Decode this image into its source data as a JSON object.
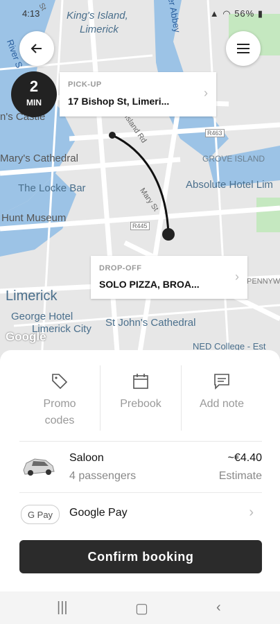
{
  "status_bar": {
    "time": "4:13",
    "battery": "56%"
  },
  "map": {
    "labels": [
      {
        "id": "kings-island",
        "text": "King's Island,"
      },
      {
        "id": "limerick-sub",
        "text": "Limerick"
      },
      {
        "id": "castle",
        "text": "n's Castle"
      },
      {
        "id": "marys",
        "text": "Mary's Cathedral"
      },
      {
        "id": "locke",
        "text": "The Locke Bar"
      },
      {
        "id": "hunt",
        "text": "Hunt Museum"
      },
      {
        "id": "limerick",
        "text": "Limerick"
      },
      {
        "id": "george",
        "text": "George Hotel"
      },
      {
        "id": "george2",
        "text": "Limerick City"
      },
      {
        "id": "johns",
        "text": "St John's Cathedral"
      },
      {
        "id": "absolute",
        "text": "Absolute Hotel Lim"
      },
      {
        "id": "grove",
        "text": "GROVE ISLAND"
      },
      {
        "id": "ned",
        "text": "NED College - Est"
      },
      {
        "id": "pennyw",
        "text": "PENNYW"
      },
      {
        "id": "island-rd",
        "text": "Island Rd"
      },
      {
        "id": "mary-st",
        "text": "Mary St"
      },
      {
        "id": "abbey",
        "text": "er Abbey"
      },
      {
        "id": "river",
        "text": "River S"
      },
      {
        "id": "r463",
        "text": "R463"
      },
      {
        "id": "r445",
        "text": "R445"
      },
      {
        "id": "st",
        "text": "St"
      }
    ],
    "google_logo": "Google"
  },
  "eta": {
    "value": "2",
    "unit": "MIN"
  },
  "pickup": {
    "label": "PICK-UP",
    "address": "17 Bishop St, Limeri..."
  },
  "dropoff": {
    "label": "DROP-OFF",
    "address": "SOLO PIZZA, BROA..."
  },
  "options": [
    {
      "label": "Promo\ncodes",
      "icon": "tag-icon"
    },
    {
      "label": "Prebook",
      "icon": "calendar-icon"
    },
    {
      "label": "Add note",
      "icon": "chat-icon"
    }
  ],
  "ride": {
    "name": "Saloon",
    "passengers": "4 passengers",
    "price": "~€4.40",
    "price_note": "Estimate"
  },
  "payment": {
    "badge": "G Pay",
    "method": "Google Pay"
  },
  "confirm_label": "Confirm booking"
}
